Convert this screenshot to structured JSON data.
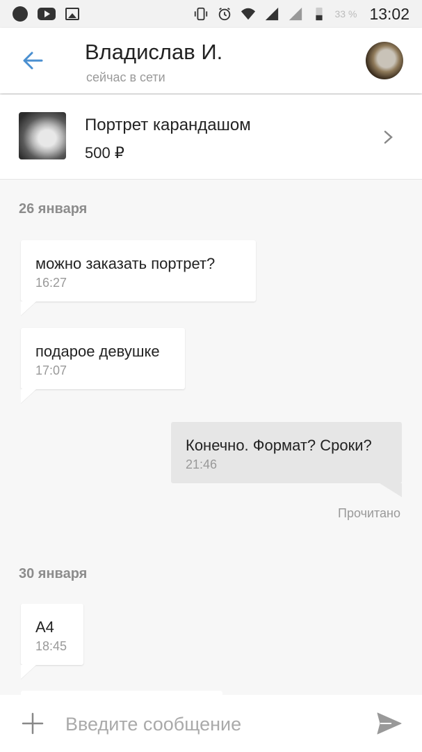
{
  "status_bar": {
    "time": "13:02",
    "battery_text": "33 %"
  },
  "header": {
    "contact_name": "Владислав И.",
    "contact_status": "сейчас в сети"
  },
  "product": {
    "title": "Портрет карандашом",
    "price": "500 ₽"
  },
  "chat": {
    "day1": {
      "date": "26 января",
      "messages": [
        {
          "text": "можно заказать портрет?",
          "time": "16:27"
        },
        {
          "text": "подарое девушке",
          "time": "17:07"
        },
        {
          "text": "Конечно. Формат? Сроки?",
          "time": "21:46"
        }
      ],
      "read_status": "Прочитано"
    },
    "day2": {
      "date": "30 января",
      "messages": [
        {
          "text": "А4",
          "time": "18:45"
        }
      ]
    }
  },
  "input": {
    "placeholder": "Введите сообщение"
  },
  "colors": {
    "accent": "#4a8fd0",
    "outgoing_bubble": "#e6e6e6",
    "background": "#f7f7f7"
  }
}
